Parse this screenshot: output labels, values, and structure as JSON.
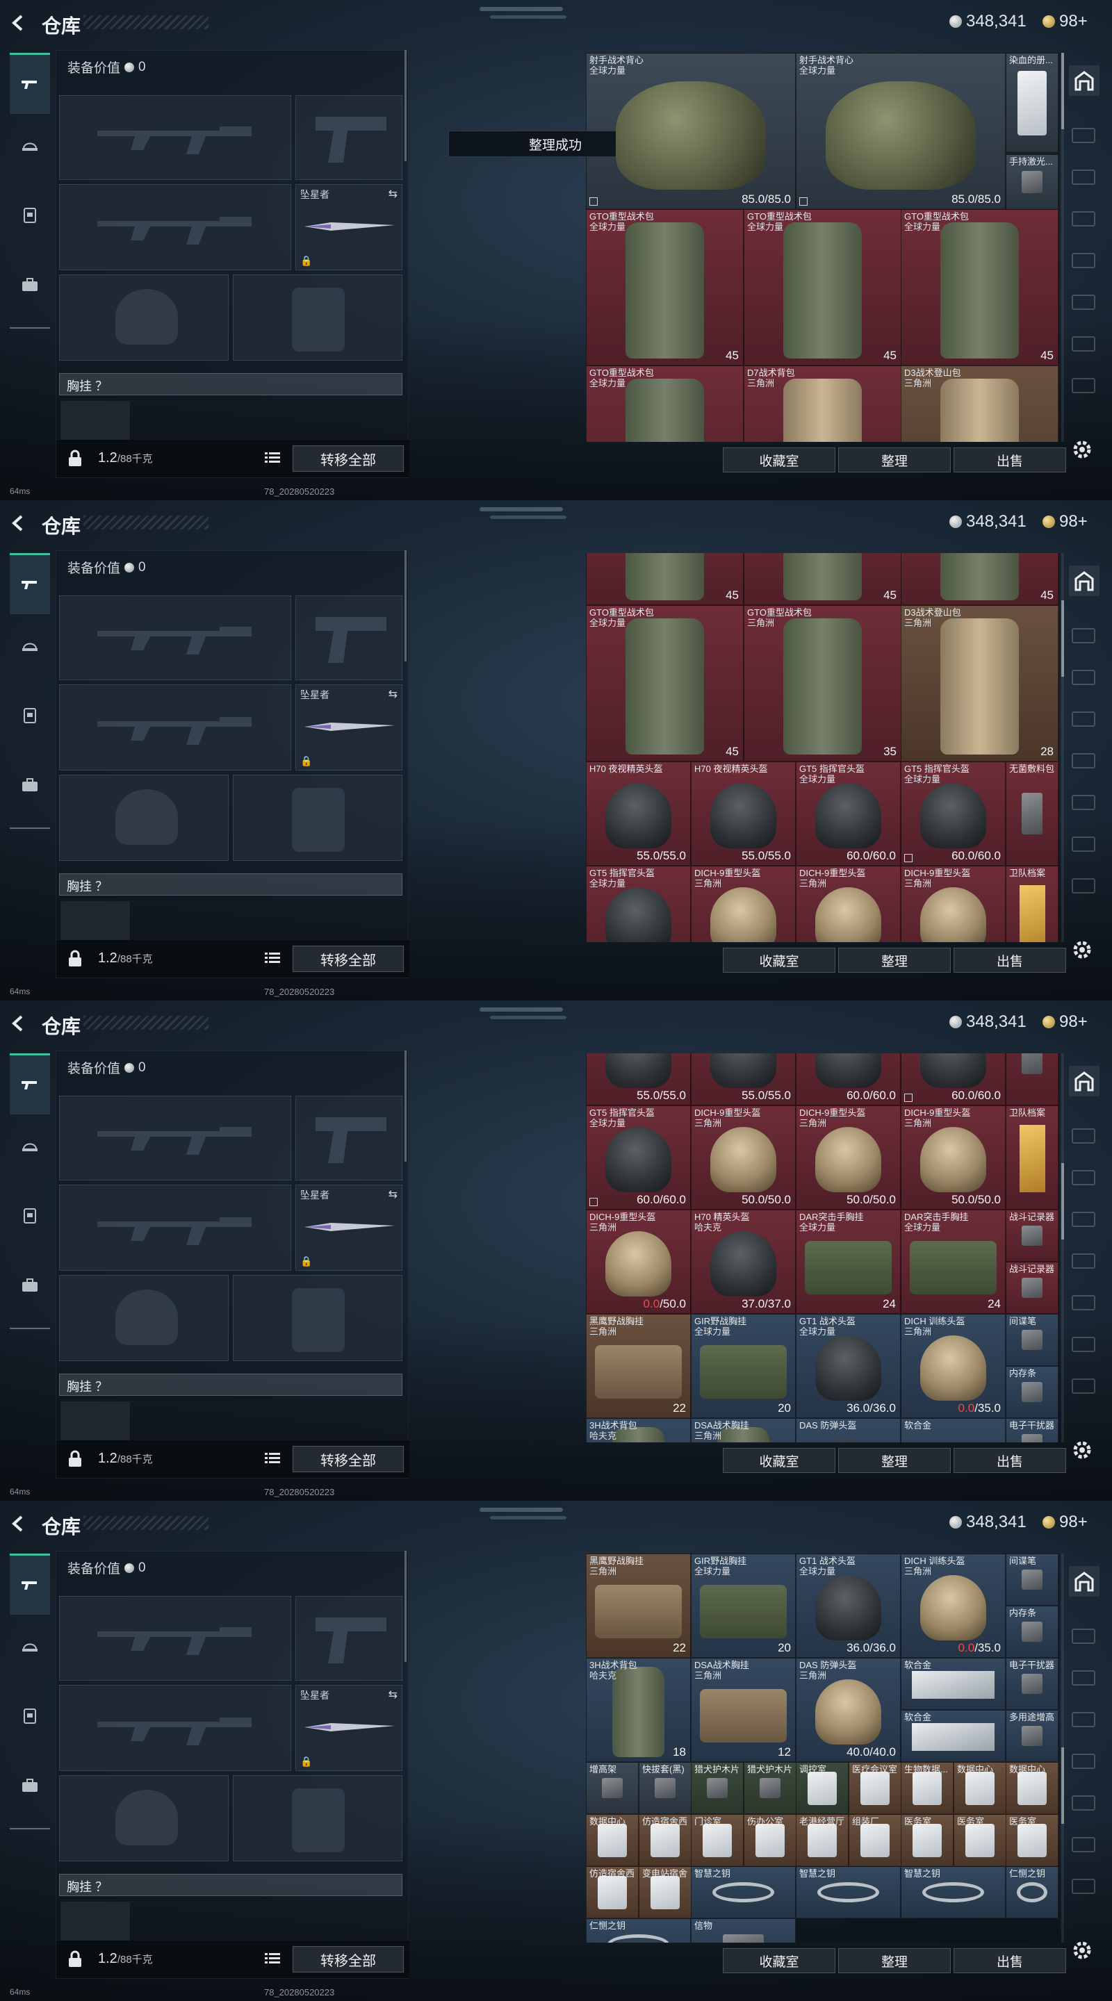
{
  "page": {
    "title": "仓库",
    "currency_silver": "348,341",
    "currency_gold": "98+"
  },
  "equipment": {
    "value_label": "装备价值",
    "value": "0",
    "melee_label": "坠星者",
    "vest_label": "胸挂",
    "vest_hint": "？",
    "weight": "1.2",
    "weight_max": "/88千克",
    "transfer_all": "转移全部"
  },
  "toast": "整理成功",
  "stash_buttons": {
    "collection": "收藏室",
    "sort": "整理",
    "sell": "出售"
  },
  "status": {
    "ping": "64ms",
    "uid": "78_20280520223"
  },
  "screens": [
    {
      "scroll": 0.0,
      "items": [
        {
          "c": 0,
          "r": 0,
          "w": 2,
          "h": 1.5,
          "bg": "gray",
          "art": "vest",
          "name": "射手战术背心",
          "sub": "全球力量",
          "val": "85.0/85.0",
          "flag": true
        },
        {
          "c": 2,
          "r": 0,
          "w": 2,
          "h": 1.5,
          "bg": "gray",
          "art": "vest",
          "name": "射手战术背心",
          "sub": "全球力量",
          "val": "85.0/85.0",
          "flag": true
        },
        {
          "c": 4,
          "r": 0,
          "w": 0.5,
          "h": 0.95,
          "bg": "gray",
          "art": "card",
          "name": "染血的册..."
        },
        {
          "c": 4,
          "r": 0.97,
          "w": 0.5,
          "h": 0.53,
          "bg": "gray",
          "art": "gadget",
          "name": "手持激光..."
        },
        {
          "c": 0,
          "r": 1.5,
          "w": 1.5,
          "h": 1.5,
          "bg": "red",
          "art": "bag",
          "name": "GTO重型战术包",
          "sub": "全球力量",
          "val": "45"
        },
        {
          "c": 1.5,
          "r": 1.5,
          "w": 1.5,
          "h": 1.5,
          "bg": "red",
          "art": "bag",
          "name": "GTO重型战术包",
          "sub": "全球力量",
          "val": "45"
        },
        {
          "c": 3,
          "r": 1.5,
          "w": 1.5,
          "h": 1.5,
          "bg": "red",
          "art": "bag",
          "name": "GTO重型战术包",
          "sub": "全球力量",
          "val": "45"
        },
        {
          "c": 0,
          "r": 3,
          "w": 1.5,
          "h": 1.5,
          "bg": "red",
          "art": "bag",
          "name": "GTO重型战术包",
          "sub": "全球力量"
        },
        {
          "c": 1.5,
          "r": 3,
          "w": 1.5,
          "h": 1.5,
          "bg": "red",
          "art": "bagtan",
          "name": "D7战术背包",
          "sub": "三角洲"
        },
        {
          "c": 3,
          "r": 3,
          "w": 1.5,
          "h": 1.5,
          "bg": "brown",
          "art": "bagtan",
          "name": "D3战术登山包",
          "sub": "三角洲"
        }
      ]
    },
    {
      "scroll": 0.15,
      "items": [
        {
          "c": 0,
          "r": -0.5,
          "w": 1.5,
          "h": 1,
          "bg": "red",
          "art": "bag",
          "val": "45"
        },
        {
          "c": 1.5,
          "r": -0.5,
          "w": 1.5,
          "h": 1,
          "bg": "red",
          "art": "bag",
          "val": "45"
        },
        {
          "c": 3,
          "r": -0.5,
          "w": 1.5,
          "h": 1,
          "bg": "red",
          "art": "bag",
          "val": "45"
        },
        {
          "c": 0,
          "r": 0.5,
          "w": 1.5,
          "h": 1.5,
          "bg": "red",
          "art": "bag",
          "name": "GTO重型战术包",
          "sub": "全球力量",
          "val": "45"
        },
        {
          "c": 1.5,
          "r": 0.5,
          "w": 1.5,
          "h": 1.5,
          "bg": "red",
          "art": "bag",
          "name": "GTO重型战术包",
          "sub": "三角洲",
          "val": "35"
        },
        {
          "c": 3,
          "r": 0.5,
          "w": 1.5,
          "h": 1.5,
          "bg": "brown",
          "art": "bagtan",
          "name": "D3战术登山包",
          "sub": "三角洲",
          "val": "28"
        },
        {
          "c": 0,
          "r": 2,
          "w": 1,
          "h": 1,
          "bg": "red",
          "art": "helmet",
          "name": "H70 夜视精英头盔",
          "val": "55.0/55.0"
        },
        {
          "c": 1,
          "r": 2,
          "w": 1,
          "h": 1,
          "bg": "red",
          "art": "helmet",
          "name": "H70 夜视精英头盔",
          "val": "55.0/55.0"
        },
        {
          "c": 2,
          "r": 2,
          "w": 1,
          "h": 1,
          "bg": "red",
          "art": "helmet",
          "name": "GT5 指挥官头盔",
          "sub": "全球力量",
          "val": "60.0/60.0"
        },
        {
          "c": 3,
          "r": 2,
          "w": 1,
          "h": 1,
          "bg": "red",
          "art": "helmet",
          "name": "GT5 指挥官头盔",
          "sub": "全球力量",
          "val": "60.0/60.0",
          "flag": true
        },
        {
          "c": 4,
          "r": 2,
          "w": 0.5,
          "h": 1,
          "bg": "red",
          "art": "gadget",
          "name": "无菌敷料包"
        },
        {
          "c": 0,
          "r": 3,
          "w": 1,
          "h": 1,
          "bg": "red",
          "art": "helmet",
          "name": "GT5 指挥官头盔",
          "sub": "全球力量"
        },
        {
          "c": 1,
          "r": 3,
          "w": 1,
          "h": 1,
          "bg": "red",
          "art": "helmettan",
          "name": "DICH-9重型头盔",
          "sub": "三角洲"
        },
        {
          "c": 2,
          "r": 3,
          "w": 1,
          "h": 1,
          "bg": "red",
          "art": "helmettan",
          "name": "DICH-9重型头盔",
          "sub": "三角洲"
        },
        {
          "c": 3,
          "r": 3,
          "w": 1,
          "h": 1,
          "bg": "red",
          "art": "helmettan",
          "name": "DICH-9重型头盔",
          "sub": "三角洲"
        },
        {
          "c": 4,
          "r": 3,
          "w": 0.5,
          "h": 1,
          "bg": "red",
          "art": "book",
          "name": "卫队档案"
        }
      ]
    },
    {
      "scroll": 0.35,
      "items": [
        {
          "c": 0,
          "r": -0.5,
          "w": 1,
          "h": 1,
          "bg": "red",
          "art": "helmet",
          "val": "55.0/55.0"
        },
        {
          "c": 1,
          "r": -0.5,
          "w": 1,
          "h": 1,
          "bg": "red",
          "art": "helmet",
          "val": "55.0/55.0"
        },
        {
          "c": 2,
          "r": -0.5,
          "w": 1,
          "h": 1,
          "bg": "red",
          "art": "helmet",
          "val": "60.0/60.0"
        },
        {
          "c": 3,
          "r": -0.5,
          "w": 1,
          "h": 1,
          "bg": "red",
          "art": "helmet",
          "val": "60.0/60.0",
          "flag": true
        },
        {
          "c": 4,
          "r": -0.5,
          "w": 0.5,
          "h": 1,
          "bg": "red",
          "art": "gadget"
        },
        {
          "c": 0,
          "r": 0.5,
          "w": 1,
          "h": 1,
          "bg": "red",
          "art": "helmet",
          "name": "GT5 指挥官头盔",
          "sub": "全球力量",
          "val": "60.0/60.0",
          "flag": true
        },
        {
          "c": 1,
          "r": 0.5,
          "w": 1,
          "h": 1,
          "bg": "red",
          "art": "helmettan",
          "name": "DICH-9重型头盔",
          "sub": "三角洲",
          "val": "50.0/50.0"
        },
        {
          "c": 2,
          "r": 0.5,
          "w": 1,
          "h": 1,
          "bg": "red",
          "art": "helmettan",
          "name": "DICH-9重型头盔",
          "sub": "三角洲",
          "val": "50.0/50.0"
        },
        {
          "c": 3,
          "r": 0.5,
          "w": 1,
          "h": 1,
          "bg": "red",
          "art": "helmettan",
          "name": "DICH-9重型头盔",
          "sub": "三角洲",
          "val": "50.0/50.0"
        },
        {
          "c": 4,
          "r": 0.5,
          "w": 0.5,
          "h": 1,
          "bg": "red",
          "art": "book",
          "name": "卫队档案"
        },
        {
          "c": 0,
          "r": 1.5,
          "w": 1,
          "h": 1,
          "bg": "red",
          "art": "helmettan",
          "name": "DICH-9重型头盔",
          "sub": "三角洲",
          "val": "0.0/50.0",
          "low": "0.0"
        },
        {
          "c": 1,
          "r": 1.5,
          "w": 1,
          "h": 1,
          "bg": "red",
          "art": "helmet",
          "name": "H70 精英头盔",
          "sub": "哈夫克",
          "val": "37.0/37.0"
        },
        {
          "c": 2,
          "r": 1.5,
          "w": 1,
          "h": 1,
          "bg": "red",
          "art": "rig",
          "name": "DAR突击手胸挂",
          "sub": "全球力量",
          "val": "24"
        },
        {
          "c": 3,
          "r": 1.5,
          "w": 1,
          "h": 1,
          "bg": "red",
          "art": "rig",
          "name": "DAR突击手胸挂",
          "sub": "全球力量",
          "val": "24"
        },
        {
          "c": 4,
          "r": 1.5,
          "w": 0.5,
          "h": 0.5,
          "bg": "red",
          "art": "gadget",
          "name": "战斗记录器"
        },
        {
          "c": 4,
          "r": 2,
          "w": 0.5,
          "h": 0.5,
          "bg": "red",
          "art": "gadget",
          "name": "战斗记录器"
        },
        {
          "c": 0,
          "r": 2.5,
          "w": 1,
          "h": 1,
          "bg": "brown",
          "art": "rigtan",
          "name": "黑鹰野战胸挂",
          "sub": "三角洲",
          "val": "22"
        },
        {
          "c": 1,
          "r": 2.5,
          "w": 1,
          "h": 1,
          "bg": "blue",
          "art": "rig",
          "name": "GIR野战胸挂",
          "sub": "全球力量",
          "val": "20"
        },
        {
          "c": 2,
          "r": 2.5,
          "w": 1,
          "h": 1,
          "bg": "blue",
          "art": "helmet",
          "name": "GT1 战术头盔",
          "sub": "全球力量",
          "val": "36.0/36.0"
        },
        {
          "c": 3,
          "r": 2.5,
          "w": 1,
          "h": 1,
          "bg": "blue",
          "art": "helmettan",
          "name": "DICH 训练头盔",
          "sub": "三角洲",
          "val": "0.0/35.0",
          "low": "0.0"
        },
        {
          "c": 4,
          "r": 2.5,
          "w": 0.5,
          "h": 0.5,
          "bg": "blue",
          "art": "gadget",
          "name": "间谍笔"
        },
        {
          "c": 4,
          "r": 3,
          "w": 0.5,
          "h": 0.5,
          "bg": "blue",
          "art": "gadget",
          "name": "内存条"
        },
        {
          "c": 0,
          "r": 3.5,
          "w": 1,
          "h": 1,
          "bg": "blue",
          "art": "bag",
          "name": "3H战术背包",
          "sub": "哈夫克"
        },
        {
          "c": 1,
          "r": 3.5,
          "w": 1,
          "h": 1,
          "bg": "blue",
          "art": "bag",
          "name": "DSA战术胸挂",
          "sub": "三角洲"
        },
        {
          "c": 2,
          "r": 3.5,
          "w": 1,
          "h": 1,
          "bg": "blue",
          "art": "helmet",
          "name": "DAS 防弹头盔"
        },
        {
          "c": 3,
          "r": 3.5,
          "w": 1,
          "h": 1,
          "bg": "blue",
          "art": "slab",
          "name": "软合金"
        },
        {
          "c": 4,
          "r": 3.5,
          "w": 0.5,
          "h": 0.5,
          "bg": "blue",
          "art": "gadget",
          "name": "电子干扰器"
        }
      ]
    },
    {
      "scroll": 0.62,
      "items": [
        {
          "c": 0,
          "r": 0,
          "w": 1,
          "h": 1,
          "bg": "brown",
          "art": "rigtan",
          "name": "黑鹰野战胸挂",
          "sub": "三角洲",
          "val": "22"
        },
        {
          "c": 1,
          "r": 0,
          "w": 1,
          "h": 1,
          "bg": "blue",
          "art": "rig",
          "name": "GIR野战胸挂",
          "sub": "全球力量",
          "val": "20"
        },
        {
          "c": 2,
          "r": 0,
          "w": 1,
          "h": 1,
          "bg": "blue",
          "art": "helmet",
          "name": "GT1 战术头盔",
          "sub": "全球力量",
          "val": "36.0/36.0"
        },
        {
          "c": 3,
          "r": 0,
          "w": 1,
          "h": 1,
          "bg": "blue",
          "art": "helmettan",
          "name": "DICH 训练头盔",
          "sub": "三角洲",
          "val": "0.0/35.0",
          "low": "0.0"
        },
        {
          "c": 4,
          "r": 0,
          "w": 0.5,
          "h": 0.5,
          "bg": "blue",
          "art": "gadget",
          "name": "间谍笔"
        },
        {
          "c": 4,
          "r": 0.5,
          "w": 0.5,
          "h": 0.5,
          "bg": "blue",
          "art": "gadget",
          "name": "内存条"
        },
        {
          "c": 0,
          "r": 1,
          "w": 1,
          "h": 1,
          "bg": "blue",
          "art": "bag",
          "name": "3H战术背包",
          "sub": "哈夫克",
          "val": "18"
        },
        {
          "c": 1,
          "r": 1,
          "w": 1,
          "h": 1,
          "bg": "blue",
          "art": "rigtan",
          "name": "DSA战术胸挂",
          "sub": "三角洲",
          "val": "12"
        },
        {
          "c": 2,
          "r": 1,
          "w": 1,
          "h": 1,
          "bg": "blue",
          "art": "helmettan",
          "name": "DAS 防弹头盔",
          "sub": "三角洲",
          "val": "40.0/40.0"
        },
        {
          "c": 3,
          "r": 1,
          "w": 1,
          "h": 0.5,
          "bg": "blue",
          "art": "slab",
          "name": "软合金"
        },
        {
          "c": 3,
          "r": 1.5,
          "w": 1,
          "h": 0.5,
          "bg": "blue",
          "art": "slab",
          "name": "软合金"
        },
        {
          "c": 4,
          "r": 1,
          "w": 0.5,
          "h": 0.5,
          "bg": "blue",
          "art": "gadget",
          "name": "电子干扰器"
        },
        {
          "c": 4,
          "r": 1.5,
          "w": 0.5,
          "h": 0.5,
          "bg": "blue",
          "art": "gadget",
          "name": "多用途增高"
        },
        {
          "c": 0,
          "r": 2,
          "w": 0.5,
          "h": 0.5,
          "bg": "gray",
          "art": "gadget",
          "name": "增高架"
        },
        {
          "c": 0.5,
          "r": 2,
          "w": 0.5,
          "h": 0.5,
          "bg": "gray",
          "art": "gadget",
          "name": "快拔套(黑)"
        },
        {
          "c": 1,
          "r": 2,
          "w": 0.5,
          "h": 0.5,
          "bg": "green",
          "art": "gadget",
          "name": "猎犬护木片"
        },
        {
          "c": 1.5,
          "r": 2,
          "w": 0.5,
          "h": 0.5,
          "bg": "green",
          "art": "gadget",
          "name": "猎犬护木片"
        },
        {
          "c": 2,
          "r": 2,
          "w": 0.5,
          "h": 0.5,
          "bg": "green",
          "art": "card",
          "name": "调控室"
        },
        {
          "c": 2.5,
          "r": 2,
          "w": 0.5,
          "h": 0.5,
          "bg": "brown",
          "art": "card",
          "name": "医疗会议室"
        },
        {
          "c": 3,
          "r": 2,
          "w": 0.5,
          "h": 0.5,
          "bg": "brown",
          "art": "card",
          "name": "生物数据..."
        },
        {
          "c": 3.5,
          "r": 2,
          "w": 0.5,
          "h": 0.5,
          "bg": "brown",
          "art": "card",
          "name": "数据中心"
        },
        {
          "c": 4,
          "r": 2,
          "w": 0.5,
          "h": 0.5,
          "bg": "brown",
          "art": "card",
          "name": "数据中心"
        },
        {
          "c": 0,
          "r": 2.5,
          "w": 0.5,
          "h": 0.5,
          "bg": "brown",
          "art": "card",
          "name": "数据中心"
        },
        {
          "c": 0.5,
          "r": 2.5,
          "w": 0.5,
          "h": 0.5,
          "bg": "brown",
          "art": "card",
          "name": "仿造宿舍西"
        },
        {
          "c": 1,
          "r": 2.5,
          "w": 0.5,
          "h": 0.5,
          "bg": "brown",
          "art": "card",
          "name": "门诊室"
        },
        {
          "c": 1.5,
          "r": 2.5,
          "w": 0.5,
          "h": 0.5,
          "bg": "brown",
          "art": "card",
          "name": "伤办公室"
        },
        {
          "c": 2,
          "r": 2.5,
          "w": 0.5,
          "h": 0.5,
          "bg": "brown",
          "art": "card",
          "name": "老港经营厅"
        },
        {
          "c": 2.5,
          "r": 2.5,
          "w": 0.5,
          "h": 0.5,
          "bg": "brown",
          "art": "card",
          "name": "组装厂"
        },
        {
          "c": 3,
          "r": 2.5,
          "w": 0.5,
          "h": 0.5,
          "bg": "brown",
          "art": "card",
          "name": "医务室"
        },
        {
          "c": 3.5,
          "r": 2.5,
          "w": 0.5,
          "h": 0.5,
          "bg": "brown",
          "art": "card",
          "name": "医务室"
        },
        {
          "c": 4,
          "r": 2.5,
          "w": 0.5,
          "h": 0.5,
          "bg": "brown",
          "art": "card",
          "name": "医务室"
        },
        {
          "c": 0,
          "r": 3,
          "w": 0.5,
          "h": 0.5,
          "bg": "brown",
          "art": "card",
          "name": "仿造宿舍西"
        },
        {
          "c": 0.5,
          "r": 3,
          "w": 0.5,
          "h": 0.5,
          "bg": "brown",
          "art": "card",
          "name": "变电站宿舍"
        },
        {
          "c": 1,
          "r": 3,
          "w": 1,
          "h": 0.5,
          "bg": "blue",
          "art": "key",
          "name": "智慧之钥"
        },
        {
          "c": 2,
          "r": 3,
          "w": 1,
          "h": 0.5,
          "bg": "blue",
          "art": "key",
          "name": "智慧之钥"
        },
        {
          "c": 3,
          "r": 3,
          "w": 1,
          "h": 0.5,
          "bg": "blue",
          "art": "key",
          "name": "智慧之钥"
        },
        {
          "c": 4,
          "r": 3,
          "w": 0.5,
          "h": 0.5,
          "bg": "blue",
          "art": "key",
          "name": "仁恻之钥"
        },
        {
          "c": 0,
          "r": 3.5,
          "w": 1,
          "h": 0.5,
          "bg": "blue",
          "art": "key",
          "name": "仁恻之钥"
        },
        {
          "c": 1,
          "r": 3.5,
          "w": 1,
          "h": 0.5,
          "bg": "blue",
          "art": "gadget",
          "name": "信物"
        }
      ]
    }
  ]
}
